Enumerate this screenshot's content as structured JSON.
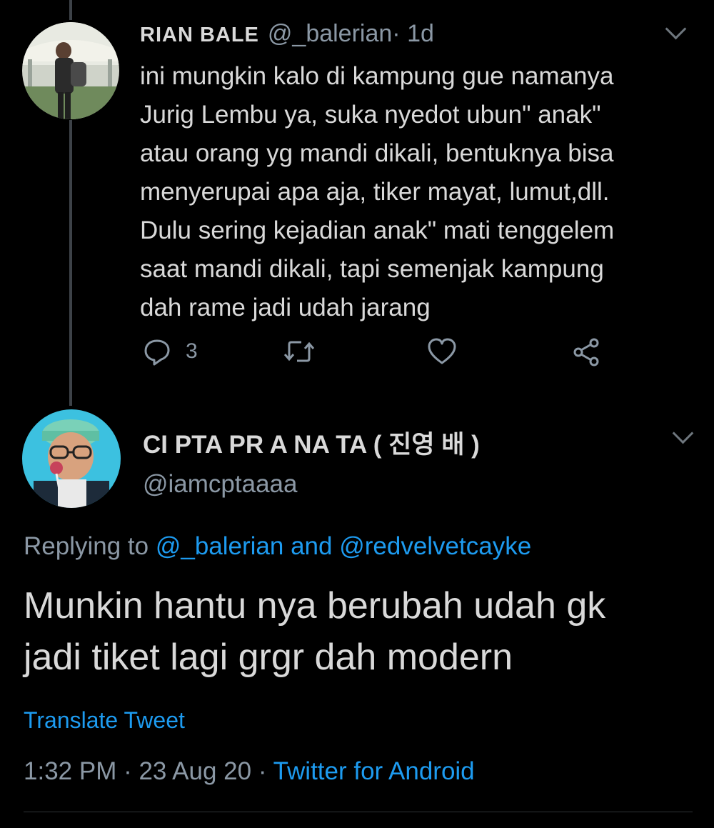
{
  "tweet1": {
    "display_name": "RIAN BALE",
    "handle": "@_balerian",
    "time": " · 1d",
    "body_lines": [
      "ini mungkin kalo di kampung gue namanya",
      "Jurig Lembu ya, suka nyedot ubun\" anak\"",
      "atau orang yg mandi dikali, bentuknya bisa",
      "menyerupai apa aja, tiker mayat, lumut,dll.",
      "Dulu sering kejadian anak\" mati tenggelem",
      "saat mandi dikali, tapi semenjak kampung",
      "dah rame jadi udah jarang"
    ],
    "reply_count": "3",
    "icons": {
      "reply": "reply-icon",
      "retweet": "retweet-icon",
      "like": "heart-icon",
      "share": "share-icon",
      "more": "chevron-down-icon"
    }
  },
  "tweet2": {
    "display_name": "CI PTA PR A NA TA ( 진영 배 )",
    "handle": "@iamcptaaaa",
    "replying_prefix": "Replying to ",
    "replying_users": "@_balerian and @redvelvetcayke",
    "body_lines": [
      "Munkin hantu nya berubah udah gk",
      "jadi tiket lagi grgr dah modern"
    ],
    "translate_label": "Translate Tweet",
    "timestamp": "1:32 PM · 23 Aug 20 · ",
    "source": "Twitter for Android"
  },
  "colors": {
    "background": "#000000",
    "text": "#d9d9d9",
    "secondary": "#8b98a5",
    "link": "#1d9bf0",
    "thread_line": "#3d4248"
  }
}
